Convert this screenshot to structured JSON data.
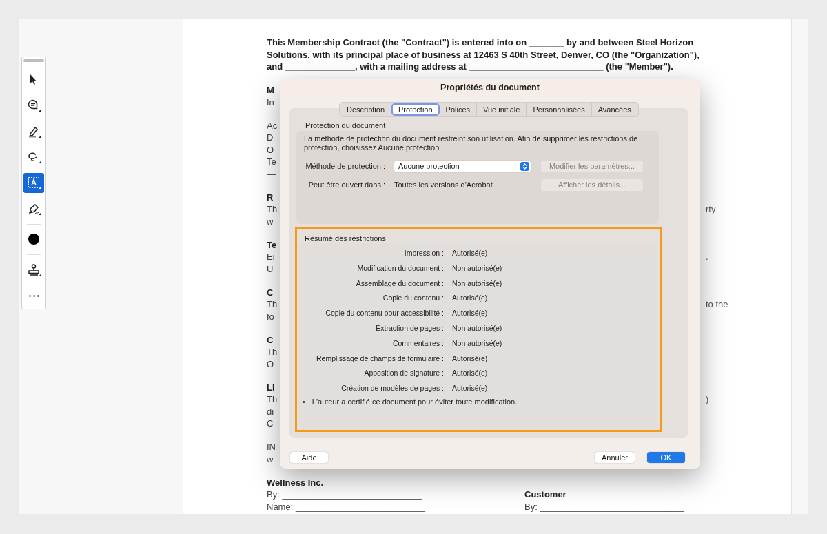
{
  "toolbar": {
    "tools": [
      {
        "kind": "handle"
      },
      {
        "kind": "pointer",
        "selected": false
      },
      {
        "kind": "comment",
        "selected": false
      },
      {
        "kind": "highlighter",
        "selected": false
      },
      {
        "kind": "lasso",
        "selected": false
      },
      {
        "kind": "text-select",
        "selected": true
      },
      {
        "kind": "pen",
        "selected": false
      },
      {
        "kind": "divider"
      },
      {
        "kind": "color",
        "color": "#000000"
      },
      {
        "kind": "divider"
      },
      {
        "kind": "stamp",
        "selected": false
      },
      {
        "kind": "more",
        "selected": false
      }
    ]
  },
  "document": {
    "paragraphs": [
      {
        "lines": [
          {
            "text": "This Membership Contract (the \"Contract\") is entered into on _______ by and between Steel Horizon",
            "bold": true
          },
          {
            "text": "Solutions, with its principal place of business at 12463 S 40th Street, Denver, CO (the \"Organization\"),",
            "bold": true
          },
          {
            "text": "and ______________, with a mailing address at ___________________________ (the \"Member\").",
            "bold": true
          }
        ]
      },
      {
        "lines": [
          {
            "text": "M",
            "bold": true
          },
          {
            "text": "In",
            "bold": false
          }
        ]
      },
      {
        "lines": [
          {
            "text": "Ac",
            "bold": false
          },
          {
            "text": "D",
            "bold": false
          },
          {
            "text": "O",
            "bold": false
          },
          {
            "text": "Te",
            "bold": false
          },
          {
            "text": "—",
            "bold": false
          }
        ]
      },
      {
        "lines": [
          {
            "text": "R",
            "bold": true
          },
          {
            "text": "Th",
            "bold": false,
            "right": "rty"
          },
          {
            "text": "w",
            "bold": false
          }
        ]
      },
      {
        "lines": [
          {
            "text": "Te",
            "bold": true
          },
          {
            "text": "Ei",
            "bold": false,
            "right": "."
          },
          {
            "text": "U",
            "bold": false
          }
        ]
      },
      {
        "lines": [
          {
            "text": "C",
            "bold": true
          },
          {
            "text": "Th",
            "bold": false,
            "right": "to the"
          },
          {
            "text": "fo",
            "bold": false
          }
        ]
      },
      {
        "lines": [
          {
            "text": "C",
            "bold": true
          },
          {
            "text": "Th",
            "bold": false
          },
          {
            "text": "O",
            "bold": false
          }
        ]
      },
      {
        "lines": [
          {
            "text": "LI",
            "bold": true
          },
          {
            "text": "Th",
            "bold": false,
            "right": ")"
          },
          {
            "text": "di",
            "bold": false
          },
          {
            "text": "C",
            "bold": false
          }
        ]
      },
      {
        "lines": [
          {
            "text": "IN",
            "bold": false
          },
          {
            "text": "w",
            "bold": false
          }
        ]
      }
    ],
    "signatures": [
      {
        "party": "Wellness Inc.",
        "fields": [
          "By: ____________________________",
          "Name: __________________________"
        ]
      },
      {
        "party": "Customer",
        "fields": [
          "By: _____________________________"
        ]
      }
    ]
  },
  "dialog": {
    "title": "Propriétés du document",
    "tabs": [
      {
        "label": "Description",
        "selected": false
      },
      {
        "label": "Protection",
        "selected": true
      },
      {
        "label": "Polices",
        "selected": false
      },
      {
        "label": "Vue initiale",
        "selected": false
      },
      {
        "label": "Personnalisées",
        "selected": false
      },
      {
        "label": "Avancées",
        "selected": false
      }
    ],
    "protection": {
      "title": "Protection du document",
      "description": "La méthode de protection du document restreint son utilisation. Afin de supprimer les restrictions de protection, choisissez Aucune protection.",
      "rows": [
        {
          "label": "Méthode de protection :",
          "kind": "select",
          "value": "Aucune protection",
          "button": {
            "label": "Modifier les paramètres...",
            "disabled": true
          }
        },
        {
          "label": "Peut être ouvert dans :",
          "kind": "text",
          "value": "Toutes les versions d'Acrobat",
          "button": {
            "label": "Afficher les détails...",
            "disabled": true
          }
        }
      ]
    },
    "restrictions": {
      "title": "Résumé des restrictions",
      "highlighted": true,
      "rows": [
        {
          "label": "Impression :",
          "value": "Autorisé(e)"
        },
        {
          "label": "Modification du document :",
          "value": "Non autorisé(e)"
        },
        {
          "label": "Assemblage du document :",
          "value": "Non autorisé(e)"
        },
        {
          "label": "Copie du contenu :",
          "value": "Autorisé(e)"
        },
        {
          "label": "Copie du contenu pour accessibilité :",
          "value": "Autorisé(e)"
        },
        {
          "label": "Extraction de pages :",
          "value": "Non autorisé(e)"
        },
        {
          "label": "Commentaires :",
          "value": "Non autorisé(e)"
        },
        {
          "label": "Remplissage de champs de formulaire :",
          "value": "Autorisé(e)"
        },
        {
          "label": "Apposition de signature :",
          "value": "Autorisé(e)"
        },
        {
          "label": "Création de modèles de pages :",
          "value": "Autorisé(e)"
        }
      ],
      "note": {
        "bullet": "•",
        "text": "L'auteur a certifié ce document pour éviter toute modification."
      }
    },
    "buttons": [
      {
        "label": "Aide",
        "kind": "help"
      },
      {
        "label": "Annuler",
        "kind": "cancel"
      },
      {
        "label": "OK",
        "kind": "default"
      }
    ]
  }
}
